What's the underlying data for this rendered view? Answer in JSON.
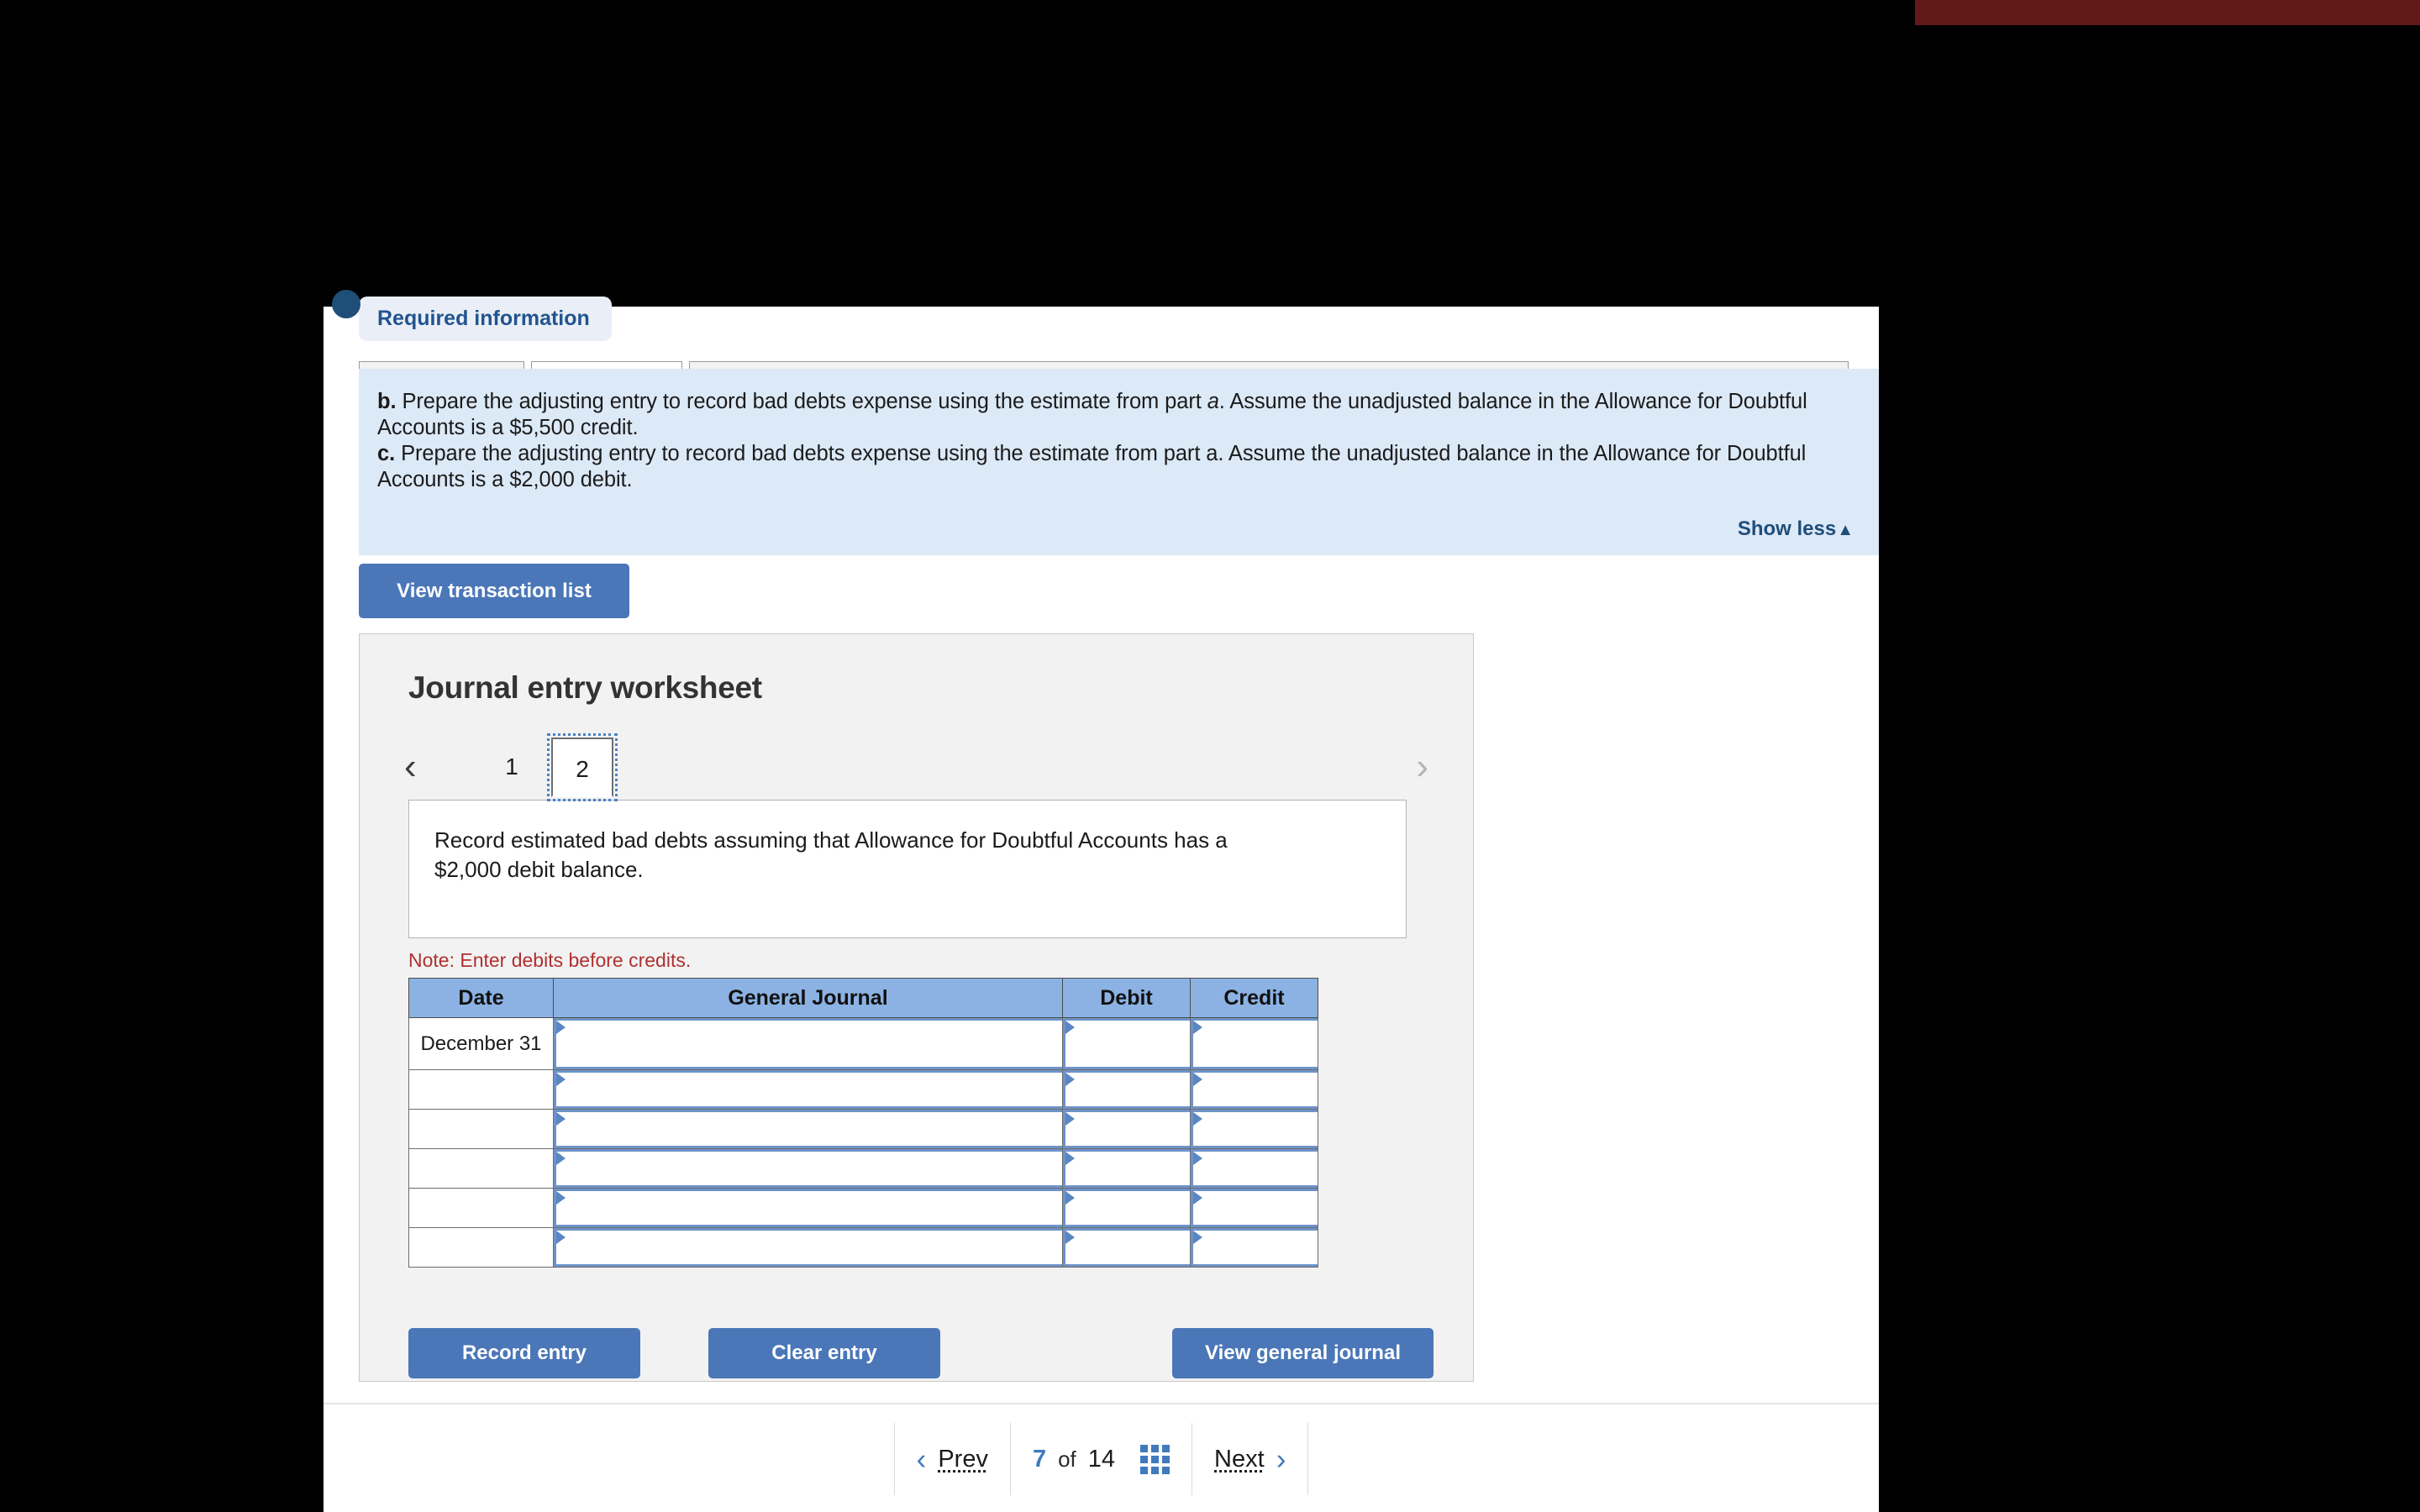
{
  "colors": {
    "accent_blue": "#4B77B8",
    "header_blue": "#8BB2E3",
    "banner_blue": "#DCE9F7",
    "link_blue": "#1F4E79",
    "note_red": "#B03030",
    "top_strip_red": "#611A17"
  },
  "required_info": {
    "pill_label": "Required information",
    "items": [
      {
        "marker": "b.",
        "text": " Prepare the adjusting entry to record bad debts expense using the estimate from part ",
        "italic": "a",
        "text_after": ". Assume the unadjusted balance in the Allowance for Doubtful Accounts is a $5,500 credit."
      },
      {
        "marker": "c.",
        "text": " Prepare the adjusting entry to record bad debts expense using the estimate from part a. Assume the unadjusted balance in the Allowance for Doubtful Accounts is a $2,000 debit.",
        "italic": "",
        "text_after": ""
      }
    ],
    "show_less_label": "Show less",
    "show_less_caret": "▲"
  },
  "toolbar": {
    "view_transaction_list": "View transaction list"
  },
  "worksheet": {
    "title": "Journal entry worksheet",
    "pager": {
      "prev_icon": "‹",
      "next_icon": "›",
      "tabs": [
        "1",
        "2"
      ],
      "selected": "2"
    },
    "scenario_text": "Record estimated bad debts assuming that Allowance for Doubtful Accounts has a $2,000 debit balance.",
    "note": "Note: Enter debits before credits.",
    "table": {
      "headers": [
        "Date",
        "General Journal",
        "Debit",
        "Credit"
      ],
      "rows": [
        {
          "date": "December 31",
          "general_journal": "",
          "debit": "",
          "credit": ""
        },
        {
          "date": "",
          "general_journal": "",
          "debit": "",
          "credit": ""
        },
        {
          "date": "",
          "general_journal": "",
          "debit": "",
          "credit": ""
        },
        {
          "date": "",
          "general_journal": "",
          "debit": "",
          "credit": ""
        },
        {
          "date": "",
          "general_journal": "",
          "debit": "",
          "credit": ""
        },
        {
          "date": "",
          "general_journal": "",
          "debit": "",
          "credit": ""
        }
      ]
    },
    "actions": {
      "record_entry": "Record entry",
      "clear_entry": "Clear entry",
      "view_general_journal": "View general journal"
    }
  },
  "bottom_nav": {
    "prev_label": "Prev",
    "prev_icon": "‹",
    "next_label": "Next",
    "next_icon": "›",
    "current_page": "7",
    "of_label": "of",
    "total_pages": "14",
    "grid_icon": "grid-icon"
  }
}
